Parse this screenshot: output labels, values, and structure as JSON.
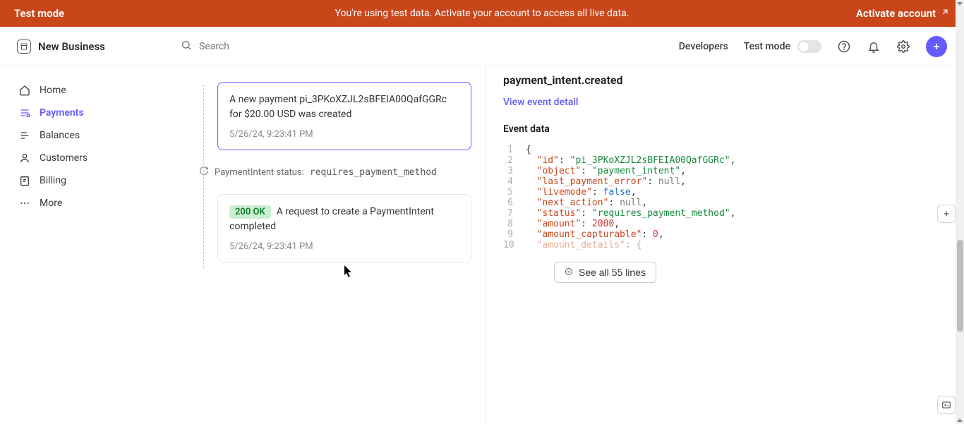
{
  "banner": {
    "left": "Test mode",
    "center": "You're using test data. Activate your account to access all live data.",
    "action": "Activate account"
  },
  "header": {
    "business_name": "New Business",
    "search_placeholder": "Search",
    "developers_label": "Developers",
    "testmode_label": "Test mode"
  },
  "sidebar": {
    "items": [
      {
        "label": "Home"
      },
      {
        "label": "Payments"
      },
      {
        "label": "Balances"
      },
      {
        "label": "Customers"
      },
      {
        "label": "Billing"
      },
      {
        "label": "More"
      }
    ]
  },
  "timeline": {
    "event1": {
      "text": "A new payment pi_3PKoXZJL2sBFEIA00QafGGRc for $20.00 USD was created",
      "time": "5/26/24, 9:23:41 PM"
    },
    "status": {
      "label": "PaymentIntent status:",
      "value": "requires_payment_method"
    },
    "event2": {
      "badge": "200 OK",
      "text": "A request to create a PaymentIntent completed",
      "time": "5/26/24, 9:23:41 PM"
    }
  },
  "detail": {
    "event_name": "payment_intent.created",
    "view_link": "View event detail",
    "section_label": "Event data",
    "code_lines": [
      {
        "n": "1",
        "indent": "",
        "key": null,
        "val": "{",
        "type": "punc"
      },
      {
        "n": "2",
        "indent": "  ",
        "key": "id",
        "val": "\"pi_3PKoXZJL2sBFEIA00QafGGRc\"",
        "type": "str",
        "comma": true
      },
      {
        "n": "3",
        "indent": "  ",
        "key": "object",
        "val": "\"payment_intent\"",
        "type": "str",
        "comma": true
      },
      {
        "n": "4",
        "indent": "  ",
        "key": "last_payment_error",
        "val": "null",
        "type": "null",
        "comma": true
      },
      {
        "n": "5",
        "indent": "  ",
        "key": "livemode",
        "val": "false",
        "type": "bool",
        "comma": true
      },
      {
        "n": "6",
        "indent": "  ",
        "key": "next_action",
        "val": "null",
        "type": "null",
        "comma": true
      },
      {
        "n": "7",
        "indent": "  ",
        "key": "status",
        "val": "\"requires_payment_method\"",
        "type": "str",
        "comma": true
      },
      {
        "n": "8",
        "indent": "  ",
        "key": "amount",
        "val": "2000",
        "type": "num",
        "comma": true
      },
      {
        "n": "9",
        "indent": "  ",
        "key": "amount_capturable",
        "val": "0",
        "type": "num",
        "comma": true
      },
      {
        "n": "10",
        "indent": "  ",
        "key": "amount_details",
        "val": "{",
        "type": "punc",
        "faded": true
      }
    ],
    "expand_label": "See all 55 lines"
  }
}
